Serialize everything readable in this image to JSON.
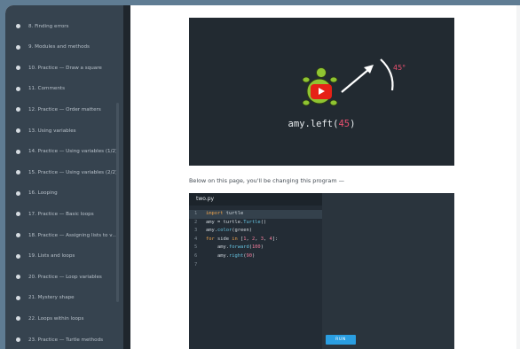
{
  "sidebar": {
    "items": [
      {
        "label": "8. Finding errors"
      },
      {
        "label": "9. Modules and methods"
      },
      {
        "label": "10. Practice — Draw a square"
      },
      {
        "label": "11. Comments"
      },
      {
        "label": "12. Practice — Order matters"
      },
      {
        "label": "13. Using variables"
      },
      {
        "label": "14. Practice — Using variables (1/2)"
      },
      {
        "label": "15. Practice — Using variables (2/2)"
      },
      {
        "label": "16. Looping"
      },
      {
        "label": "17. Practice — Basic loops"
      },
      {
        "label": "18. Practice — Assigning lists to vari..."
      },
      {
        "label": "19. Lists and loops"
      },
      {
        "label": "20. Practice — Loop variables"
      },
      {
        "label": "21. Mystery shape"
      },
      {
        "label": "22. Loops within loops"
      },
      {
        "label": "23. Practice — Turtle methods"
      }
    ]
  },
  "video": {
    "code_prefix": "amy.left(",
    "code_arg": "45",
    "code_suffix": ")",
    "angle_label": "45°",
    "colors": {
      "number": "#e9506f",
      "turtle_shell": "#8fc431",
      "play": "#e62117"
    }
  },
  "main": {
    "below_text": "Below on this page, you'll be changing this program —"
  },
  "editor": {
    "tab_label": "two.py",
    "lines": [
      {
        "n": "1",
        "parts": [
          {
            "t": "import",
            "c": "kw"
          },
          {
            "t": " turtle",
            "c": ""
          }
        ]
      },
      {
        "n": "2",
        "parts": [
          {
            "t": "amy = turtle.",
            "c": ""
          },
          {
            "t": "Turtle",
            "c": "fn"
          },
          {
            "t": "()",
            "c": ""
          }
        ]
      },
      {
        "n": "3",
        "parts": [
          {
            "t": "amy.",
            "c": ""
          },
          {
            "t": "color",
            "c": "fn"
          },
          {
            "t": "(green)",
            "c": ""
          }
        ]
      },
      {
        "n": "4",
        "parts": [
          {
            "t": "for",
            "c": "kw"
          },
          {
            "t": " side ",
            "c": ""
          },
          {
            "t": "in",
            "c": "kw"
          },
          {
            "t": " [",
            "c": ""
          },
          {
            "t": "1",
            "c": "num2"
          },
          {
            "t": ", ",
            "c": ""
          },
          {
            "t": "2",
            "c": "num2"
          },
          {
            "t": ", ",
            "c": ""
          },
          {
            "t": "3",
            "c": "num2"
          },
          {
            "t": ", ",
            "c": ""
          },
          {
            "t": "4",
            "c": "num2"
          },
          {
            "t": "]:",
            "c": ""
          }
        ]
      },
      {
        "n": "5",
        "parts": [
          {
            "t": "    amy.",
            "c": ""
          },
          {
            "t": "forward",
            "c": "fn"
          },
          {
            "t": "(",
            "c": ""
          },
          {
            "t": "100",
            "c": "num2"
          },
          {
            "t": ")",
            "c": ""
          }
        ]
      },
      {
        "n": "6",
        "parts": [
          {
            "t": "    amy.",
            "c": ""
          },
          {
            "t": "right",
            "c": "fn"
          },
          {
            "t": "(",
            "c": ""
          },
          {
            "t": "90",
            "c": "num2"
          },
          {
            "t": ")",
            "c": ""
          }
        ]
      },
      {
        "n": "7",
        "parts": []
      }
    ],
    "run_label": "RUN"
  }
}
